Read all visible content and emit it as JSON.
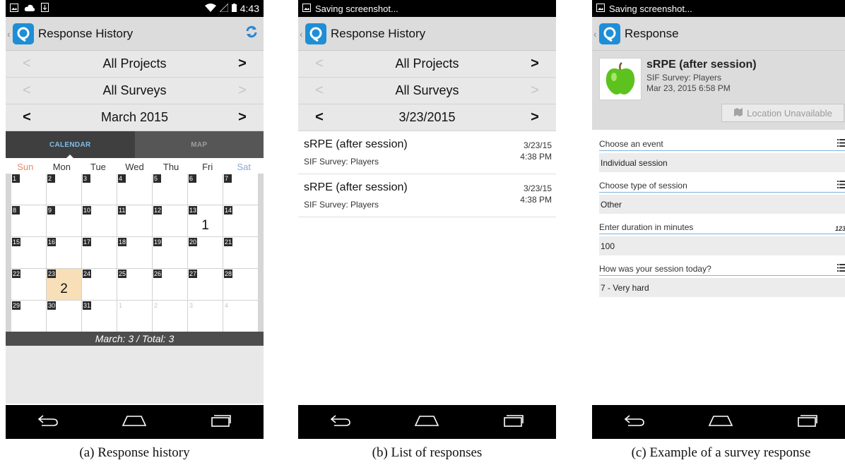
{
  "screen_a": {
    "status_time": "4:43",
    "title": "Response History",
    "selectors": [
      {
        "prev": "<",
        "label": "All Projects",
        "next": ">",
        "prev_enabled": false,
        "next_enabled": true
      },
      {
        "prev": "<",
        "label": "All Surveys",
        "next": ">",
        "prev_enabled": false,
        "next_enabled": false
      },
      {
        "prev": "<",
        "label": "March 2015",
        "next": ">",
        "prev_enabled": true,
        "next_enabled": true
      }
    ],
    "tabs": {
      "calendar": "CALENDAR",
      "map": "MAP"
    },
    "weekdays": [
      "Sun",
      "Mon",
      "Tue",
      "Wed",
      "Thu",
      "Fri",
      "Sat"
    ],
    "calendar_days": [
      {
        "day": "1"
      },
      {
        "day": "2"
      },
      {
        "day": "3"
      },
      {
        "day": "4"
      },
      {
        "day": "5"
      },
      {
        "day": "6"
      },
      {
        "day": "7"
      },
      {
        "day": "8"
      },
      {
        "day": "9"
      },
      {
        "day": "10"
      },
      {
        "day": "11"
      },
      {
        "day": "12"
      },
      {
        "day": "13",
        "count": "1"
      },
      {
        "day": "14"
      },
      {
        "day": "15"
      },
      {
        "day": "16"
      },
      {
        "day": "17"
      },
      {
        "day": "18"
      },
      {
        "day": "19"
      },
      {
        "day": "20"
      },
      {
        "day": "21"
      },
      {
        "day": "22"
      },
      {
        "day": "23",
        "count": "2",
        "highlight": true
      },
      {
        "day": "24"
      },
      {
        "day": "25"
      },
      {
        "day": "26"
      },
      {
        "day": "27"
      },
      {
        "day": "28"
      },
      {
        "day": "29"
      },
      {
        "day": "30"
      },
      {
        "day": "31"
      },
      {
        "day": "1",
        "muted": true
      },
      {
        "day": "2",
        "muted": true
      },
      {
        "day": "3",
        "muted": true
      },
      {
        "day": "4",
        "muted": true
      }
    ],
    "summary": "March: 3 / Total: 3",
    "caption": "(a)  Response history"
  },
  "screen_b": {
    "status_text": "Saving screenshot...",
    "title": "Response History",
    "selectors": [
      {
        "prev": "<",
        "label": "All Projects",
        "next": ">",
        "prev_enabled": false,
        "next_enabled": true
      },
      {
        "prev": "<",
        "label": "All Surveys",
        "next": ">",
        "prev_enabled": false,
        "next_enabled": false
      },
      {
        "prev": "<",
        "label": "3/23/2015",
        "next": ">",
        "prev_enabled": true,
        "next_enabled": true
      }
    ],
    "responses": [
      {
        "title": "sRPE (after session)",
        "subtitle": "SIF Survey: Players",
        "date": "3/23/15",
        "time": "4:38 PM"
      },
      {
        "title": "sRPE (after session)",
        "subtitle": "SIF Survey: Players",
        "date": "3/23/15",
        "time": "4:38 PM"
      }
    ],
    "caption": "(b)  List of responses"
  },
  "screen_c": {
    "status_text": "Saving screenshot...",
    "title": "Response",
    "survey_title": "sRPE (after session)",
    "survey_subtitle": "SIF Survey: Players",
    "survey_date": "Mar 23, 2015 6:58 PM",
    "location_button": "Location Unavailable",
    "fields": [
      {
        "label": "Choose an event",
        "value": "Individual session",
        "icon": "list-icon"
      },
      {
        "label": "Choose type of session",
        "value": "Other",
        "icon": "list-icon"
      },
      {
        "label": "Enter duration in minutes",
        "value": "100",
        "icon": "number-icon",
        "icon_text": "123"
      },
      {
        "label": "How was your session today?",
        "value": "7 - Very hard",
        "icon": "list-icon"
      }
    ],
    "caption": "(c)  Example of a survey response"
  },
  "colors": {
    "accent": "#1e8ed6",
    "highlight": "#f8dfb8",
    "tab_active": "#7fbde8",
    "apple_green": "#5dc21e"
  }
}
